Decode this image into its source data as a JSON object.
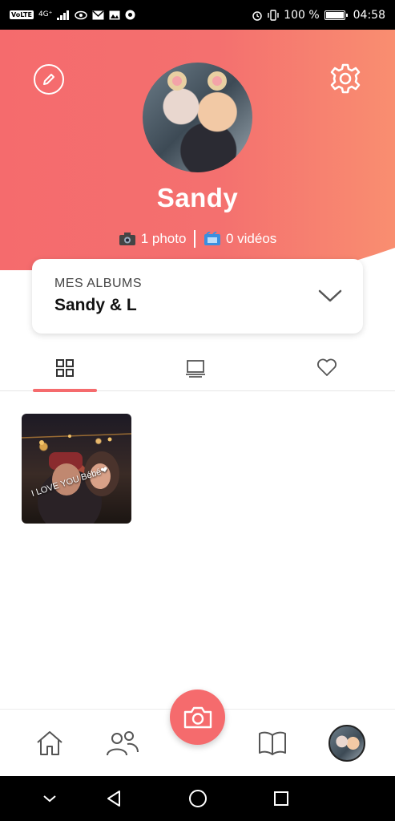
{
  "status_bar": {
    "network_chip": "VoLTE",
    "network_type": "4G⁺",
    "battery_percent": "100 %",
    "time": "04:58"
  },
  "profile": {
    "name": "Sandy",
    "photos_label": "1 photo",
    "videos_label": "0 vidéos"
  },
  "album_selector": {
    "label": "MES ALBUMS",
    "selected": "Sandy & L"
  },
  "tabs": [
    {
      "icon": "grid-icon",
      "active": true
    },
    {
      "icon": "slideshow-icon",
      "active": false
    },
    {
      "icon": "heart-icon",
      "active": false
    }
  ],
  "photos": [
    {
      "caption": "I LOVE YOU Bébé❤"
    }
  ],
  "bottom_nav": [
    {
      "icon": "home-icon"
    },
    {
      "icon": "friends-icon"
    },
    {
      "icon": "camera-icon"
    },
    {
      "icon": "book-icon"
    },
    {
      "icon": "avatar"
    }
  ],
  "colors": {
    "accent": "#f56b6d",
    "accent_end": "#f98e70"
  }
}
